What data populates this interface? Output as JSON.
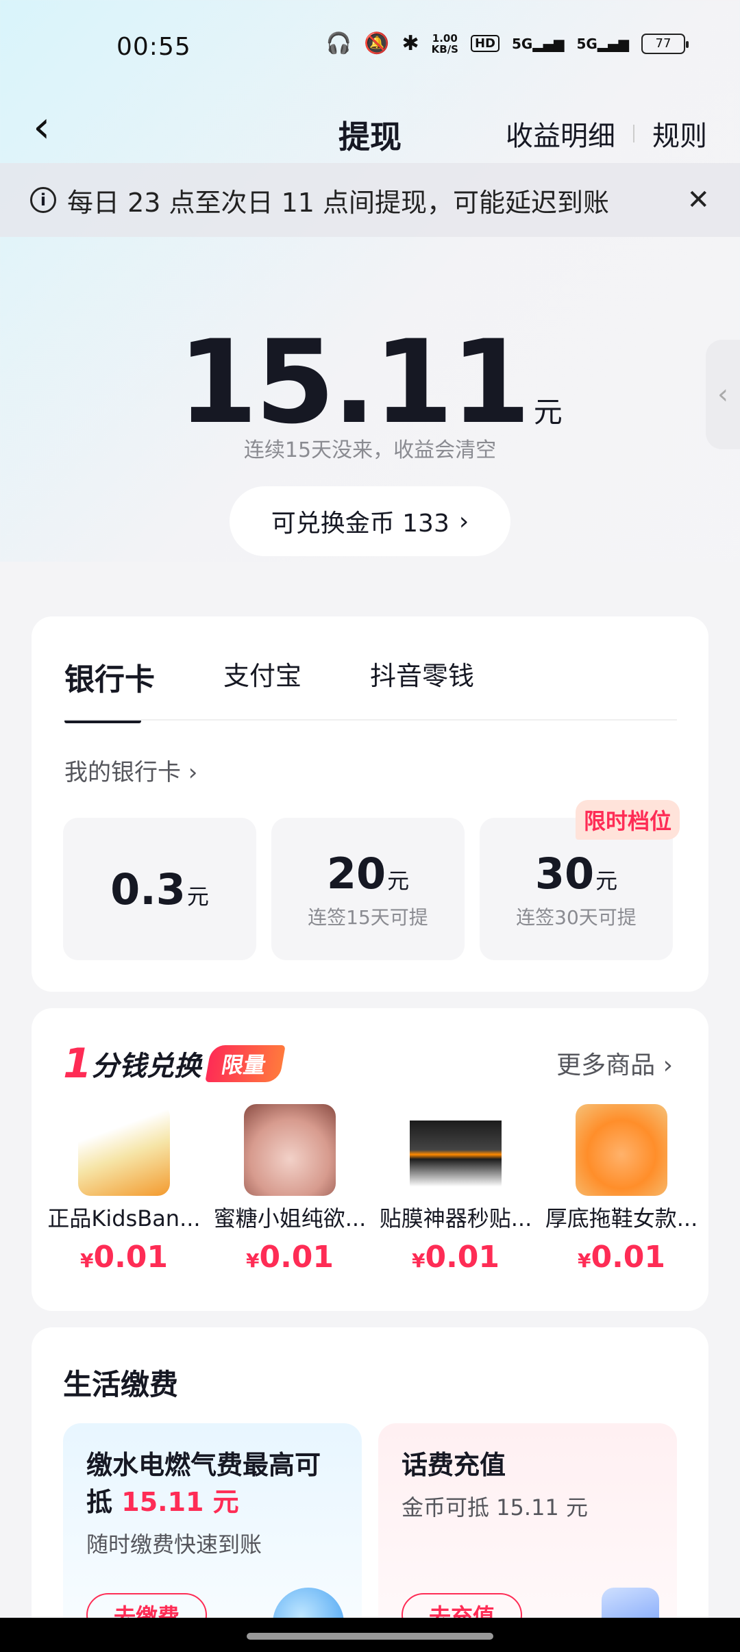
{
  "status": {
    "time": "00:55",
    "speed": "1.00\nKB/S",
    "hd": "HD",
    "net1": "5G",
    "net2": "5G",
    "battery": "77"
  },
  "nav": {
    "title": "提现",
    "details": "收益明细",
    "rules": "规则"
  },
  "notice": {
    "text": "每日 23 点至次日 11 点间提现，可能延迟到账"
  },
  "balance": {
    "amount": "15.11",
    "unit": "元",
    "hint": "连续15天没来，收益会清空"
  },
  "coins": {
    "label": "可兑换金币 133"
  },
  "tabs": [
    {
      "label": "银行卡"
    },
    {
      "label": "支付宝"
    },
    {
      "label": "抖音零钱"
    }
  ],
  "my_card": "我的银行卡",
  "tiles": [
    {
      "value": "0.3",
      "unit": "元",
      "sub": ""
    },
    {
      "value": "20",
      "unit": "元",
      "sub": "连签15天可提"
    },
    {
      "value": "30",
      "unit": "元",
      "sub": "连签30天可提",
      "badge": "限时档位"
    }
  ],
  "deals": {
    "one": "1",
    "title": "分钱兑换",
    "tag": "限量",
    "more": "更多商品",
    "items": [
      {
        "name": "正品KidsBan...",
        "yen": "¥",
        "price": "0.01"
      },
      {
        "name": "蜜糖小姐纯欲...",
        "yen": "¥",
        "price": "0.01"
      },
      {
        "name": "贴膜神器秒贴...",
        "yen": "¥",
        "price": "0.01"
      },
      {
        "name": "厚底拖鞋女款...",
        "yen": "¥",
        "price": "0.01"
      }
    ]
  },
  "life": {
    "title": "生活缴费",
    "card1": {
      "title_a": "缴水电燃气费最高可",
      "title_b": "抵",
      "amount": "15.11 元",
      "sub": "随时缴费快速到账",
      "button": "去缴费"
    },
    "card2": {
      "title": "话费充值",
      "sub": "金币可抵 15.11 元",
      "button": "去充值"
    }
  }
}
